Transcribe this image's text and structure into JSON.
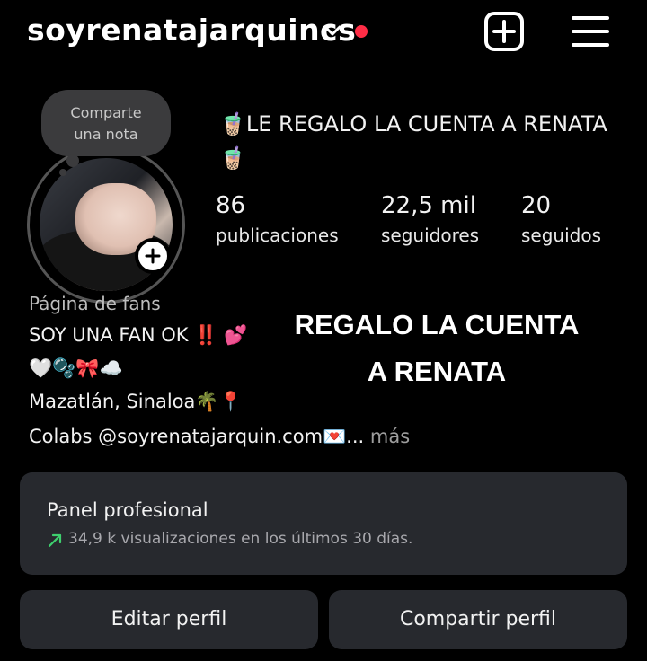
{
  "header": {
    "username": "soyrenatajarquincs",
    "icons": [
      "chevron-down-icon",
      "notification-dot",
      "create-post-icon",
      "menu-icon"
    ],
    "accent_color": "#ff2d46"
  },
  "note": {
    "line1": "Comparte",
    "line2": "una nota"
  },
  "profile": {
    "name_line1": "🧋LE REGALO LA CUENTA A RENATA",
    "name_line2": "🧋",
    "stats": [
      {
        "value": "86",
        "label": "publicaciones"
      },
      {
        "value": "22,5 mil",
        "label": "seguidores"
      },
      {
        "value": "20",
        "label": "seguidos"
      }
    ]
  },
  "bio": {
    "category": "Página de fans",
    "line1": "SOY UNA FAN OK ‼️ 💕",
    "line2": "🤍🫧🎀☁️",
    "line3": "Mazatlán, Sinaloa🌴📍",
    "line4": "Colabs @soyrenatajarquin.com💌...",
    "more": " más"
  },
  "overlay": {
    "line1": "REGALO LA CUENTA",
    "line2": "A RENATA"
  },
  "panel": {
    "title": "Panel profesional",
    "subtitle": "34,9 k visualizaciones en los últimos 30 días.",
    "trend_color": "#3ecf6e"
  },
  "buttons": {
    "edit": "Editar perfil",
    "share": "Compartir perfil"
  }
}
